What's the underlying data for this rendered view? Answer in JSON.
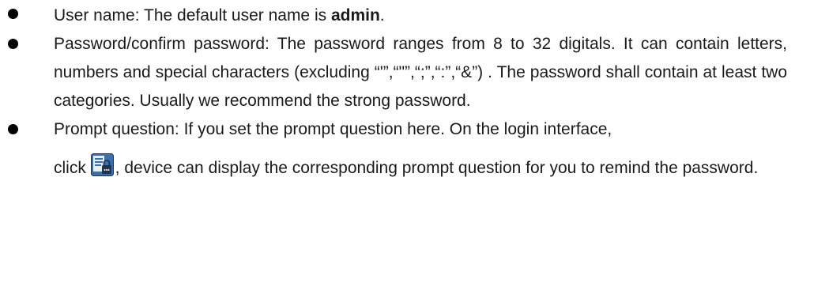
{
  "items": [
    {
      "prefix": "User name: The default user name is ",
      "bold": "admin",
      "suffix": "."
    },
    {
      "text": "Password/confirm password: The password ranges from 8 to 32 digitals. It can contain letters, numbers and special characters (excluding “'”,“\"”,“;”,“:”,“&”) . The password shall contain at least two categories. Usually we recommend the strong password."
    },
    {
      "line1": "Prompt question: If you set the prompt question here. On the login interface,",
      "click_label": "click ",
      "after_icon": ", device can display the corresponding prompt question for you to remind the password.",
      "icon": "password-prompt-icon"
    }
  ],
  "colors": {
    "icon_blue": "#3a6fb0",
    "icon_dark": "#22334d",
    "bullet": "#000000"
  }
}
